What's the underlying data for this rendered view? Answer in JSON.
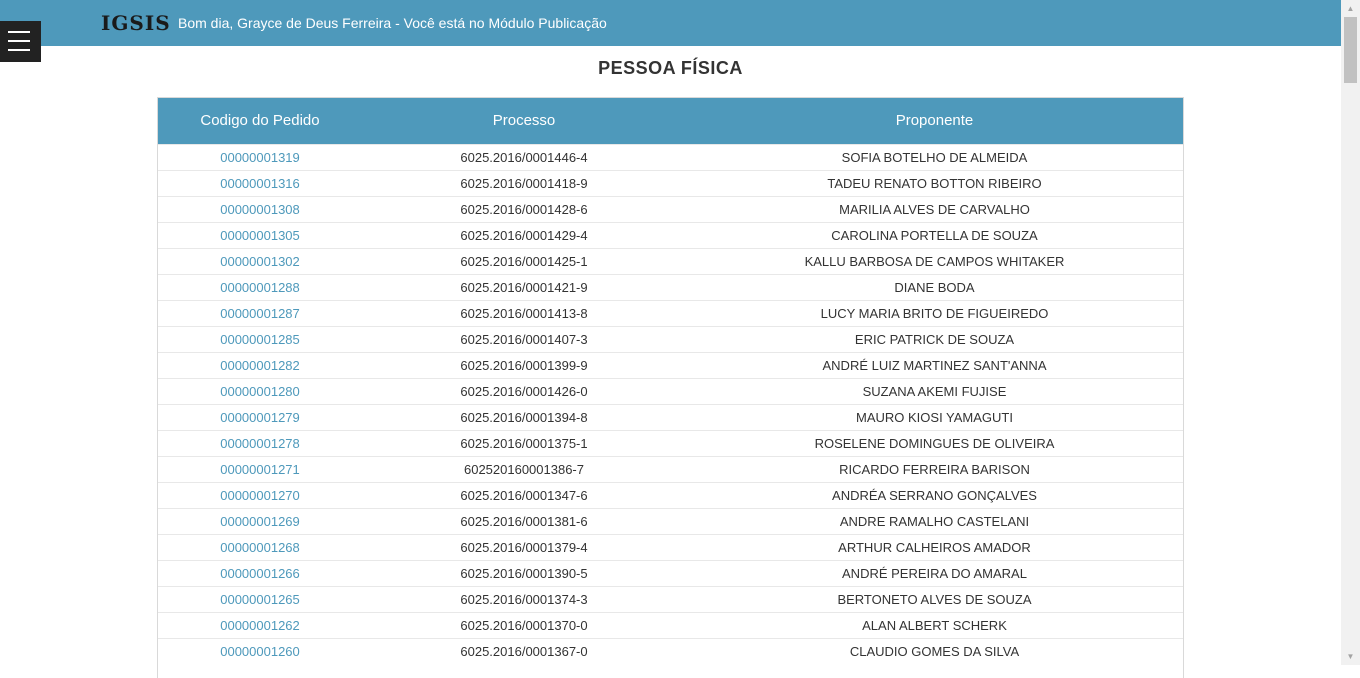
{
  "header": {
    "logo": "IGSIS",
    "greeting": "Bom dia, Grayce de Deus Ferreira - Você está no Módulo Publicação"
  },
  "page": {
    "title": "PESSOA FÍSICA"
  },
  "table": {
    "columns": [
      "Codigo do Pedido",
      "Processo",
      "Proponente"
    ],
    "rows": [
      {
        "codigo": "00000001319",
        "processo": "6025.2016/0001446-4",
        "proponente": "SOFIA BOTELHO DE ALMEIDA"
      },
      {
        "codigo": "00000001316",
        "processo": "6025.2016/0001418-9",
        "proponente": "TADEU RENATO BOTTON RIBEIRO"
      },
      {
        "codigo": "00000001308",
        "processo": "6025.2016/0001428-6",
        "proponente": "MARILIA ALVES DE CARVALHO"
      },
      {
        "codigo": "00000001305",
        "processo": "6025.2016/0001429-4",
        "proponente": "CAROLINA PORTELLA DE SOUZA"
      },
      {
        "codigo": "00000001302",
        "processo": "6025.2016/0001425-1",
        "proponente": "KALLU BARBOSA DE CAMPOS WHITAKER"
      },
      {
        "codigo": "00000001288",
        "processo": "6025.2016/0001421-9",
        "proponente": "DIANE BODA"
      },
      {
        "codigo": "00000001287",
        "processo": "6025.2016/0001413-8",
        "proponente": "LUCY MARIA BRITO DE FIGUEIREDO"
      },
      {
        "codigo": "00000001285",
        "processo": "6025.2016/0001407-3",
        "proponente": "ERIC PATRICK DE SOUZA"
      },
      {
        "codigo": "00000001282",
        "processo": "6025.2016/0001399-9",
        "proponente": "ANDRÉ LUIZ MARTINEZ SANT'ANNA"
      },
      {
        "codigo": "00000001280",
        "processo": "6025.2016/0001426-0",
        "proponente": "SUZANA AKEMI FUJISE"
      },
      {
        "codigo": "00000001279",
        "processo": "6025.2016/0001394-8",
        "proponente": "MAURO KIOSI YAMAGUTI"
      },
      {
        "codigo": "00000001278",
        "processo": "6025.2016/0001375-1",
        "proponente": "ROSELENE DOMINGUES DE OLIVEIRA"
      },
      {
        "codigo": "00000001271",
        "processo": "602520160001386-7",
        "proponente": "RICARDO FERREIRA BARISON"
      },
      {
        "codigo": "00000001270",
        "processo": "6025.2016/0001347-6",
        "proponente": "ANDRÉA SERRANO GONÇALVES"
      },
      {
        "codigo": "00000001269",
        "processo": "6025.2016/0001381-6",
        "proponente": "ANDRE RAMALHO CASTELANI"
      },
      {
        "codigo": "00000001268",
        "processo": "6025.2016/0001379-4",
        "proponente": "ARTHUR CALHEIROS AMADOR"
      },
      {
        "codigo": "00000001266",
        "processo": "6025.2016/0001390-5",
        "proponente": "ANDRÉ PEREIRA DO AMARAL"
      },
      {
        "codigo": "00000001265",
        "processo": "6025.2016/0001374-3",
        "proponente": "BERTONETO ALVES DE SOUZA"
      },
      {
        "codigo": "00000001262",
        "processo": "6025.2016/0001370-0",
        "proponente": "ALAN ALBERT SCHERK"
      },
      {
        "codigo": "00000001260",
        "processo": "6025.2016/0001367-0",
        "proponente": "CLAUDIO GOMES DA SILVA"
      }
    ]
  },
  "icons": {
    "menu": "hamburger-menu-icon",
    "scroll_up": "scroll-up-arrow-icon",
    "scroll_down": "scroll-down-arrow-icon"
  },
  "colors": {
    "header_bg": "#4e99bb",
    "link": "#4e99bb",
    "menu_bg": "#222222"
  }
}
